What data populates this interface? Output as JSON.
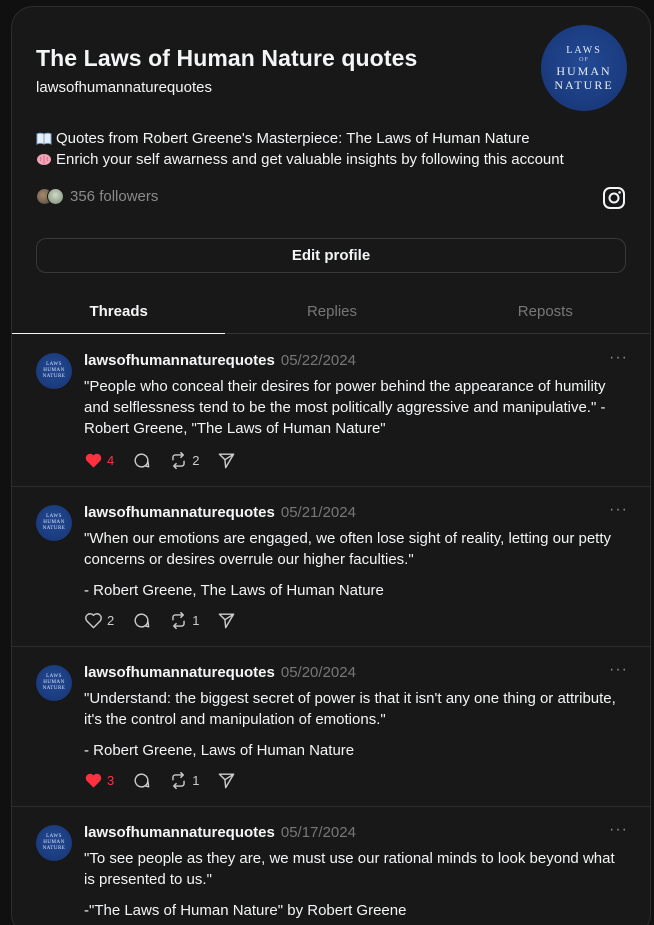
{
  "profile": {
    "title": "The Laws of Human Nature quotes",
    "handle": "lawsofhumannaturequotes",
    "avatar_text": [
      "LAWS",
      "OF",
      "HUMAN",
      "NATURE"
    ],
    "bio": [
      {
        "icon": "book-emoji",
        "text": "Quotes from Robert Greene's Masterpiece: The Laws of Human Nature"
      },
      {
        "icon": "brain-emoji",
        "text": "Enrich your self awarness and get valuable insights by following this account"
      }
    ],
    "followers": "356 followers",
    "edit_button": "Edit profile"
  },
  "tabs": [
    {
      "label": "Threads",
      "active": true
    },
    {
      "label": "Replies",
      "active": false
    },
    {
      "label": "Reposts",
      "active": false
    }
  ],
  "posts": [
    {
      "user": "lawsofhumannaturequotes",
      "date": "05/22/2024",
      "paragraphs": [
        "\"People who conceal their desires for power behind the appearance of humility and selflessness tend to be the most politically aggressive and manipulative.\" - Robert Greene, \"The Laws of Human Nature\""
      ],
      "likes": "4",
      "liked": true,
      "reposts": "2"
    },
    {
      "user": "lawsofhumannaturequotes",
      "date": "05/21/2024",
      "paragraphs": [
        "\"When our emotions are engaged, we often lose sight of reality, letting our petty concerns or desires overrule our higher faculties.\"",
        "- Robert Greene, The Laws of Human Nature"
      ],
      "likes": "2",
      "liked": false,
      "reposts": "1"
    },
    {
      "user": "lawsofhumannaturequotes",
      "date": "05/20/2024",
      "paragraphs": [
        "\"Understand: the biggest secret of power is that it isn't any one thing or attribute, it's the control and manipulation of emotions.\"",
        "- Robert Greene, Laws of Human Nature"
      ],
      "likes": "3",
      "liked": true,
      "reposts": "1"
    },
    {
      "user": "lawsofhumannaturequotes",
      "date": "05/17/2024",
      "paragraphs": [
        "\"To see people as they are, we must use our rational minds to look beyond what is presented to us.\"",
        "-\"The Laws of Human Nature\" by Robert Greene"
      ],
      "likes": "",
      "liked": false,
      "reposts": ""
    }
  ],
  "colors": {
    "background": "#181818",
    "like_red": "#ff3040",
    "avatar_blue": "#1a3a7d"
  }
}
